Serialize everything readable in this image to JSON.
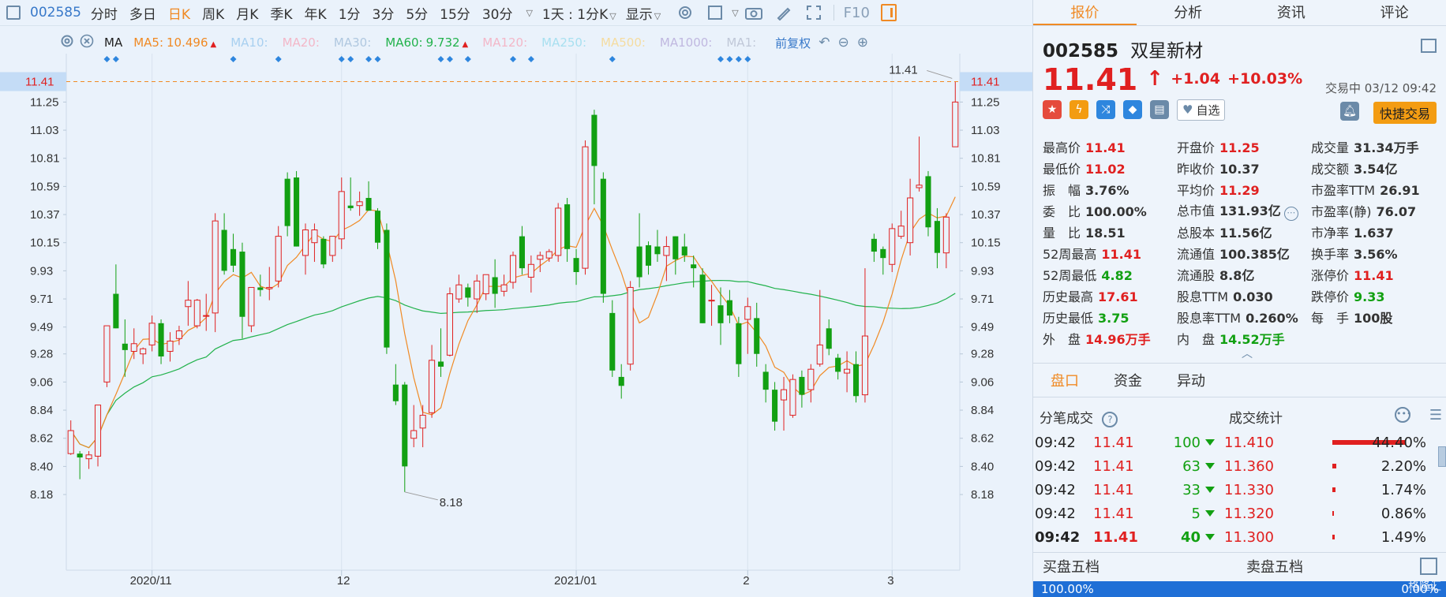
{
  "toolbar": {
    "code": "002585",
    "tabs": [
      "分时",
      "多日",
      "日K",
      "周K",
      "月K",
      "季K",
      "年K",
      "1分",
      "3分",
      "5分",
      "15分",
      "30分"
    ],
    "active_tab": "日K",
    "period_dropdown": "1天 : 1分K",
    "display_dropdown": "显示",
    "f10": "F10"
  },
  "ma_legend": {
    "selector": "MA",
    "items": [
      {
        "label": "MA5:",
        "value": "10.496",
        "color": "#f08a24",
        "up": true
      },
      {
        "label": "MA10:",
        "value": "",
        "color": "#a8d0f0",
        "up": false
      },
      {
        "label": "MA20:",
        "value": "",
        "color": "#f3b7c8",
        "up": false
      },
      {
        "label": "MA30:",
        "value": "",
        "color": "#b0c8e0",
        "up": false
      },
      {
        "label": "MA60:",
        "value": "9.732",
        "color": "#22b24c",
        "up": true
      },
      {
        "label": "MA120:",
        "value": "",
        "color": "#f3b7c8",
        "up": false
      },
      {
        "label": "MA250:",
        "value": "",
        "color": "#a8e0f0",
        "up": false
      },
      {
        "label": "MA500:",
        "value": "",
        "color": "#f5dca0",
        "up": false
      },
      {
        "label": "MA1000:",
        "value": "",
        "color": "#c0b8e0",
        "up": false
      },
      {
        "label": "MA1:",
        "value": "",
        "color": "#c0c8d8",
        "up": false
      }
    ],
    "adjust": "前复权"
  },
  "chart_data": {
    "type": "candlestick",
    "title": "",
    "y_ticks": [
      8.18,
      8.4,
      8.62,
      8.84,
      9.06,
      9.28,
      9.49,
      9.71,
      9.93,
      10.15,
      10.37,
      10.59,
      10.81,
      11.03,
      11.25
    ],
    "ylim": [
      8.02,
      11.53
    ],
    "x_labels": [
      {
        "label": "2020/11",
        "index": 9
      },
      {
        "label": "12",
        "index": 30
      },
      {
        "label": "2021/01",
        "index": 56
      },
      {
        "label": "2",
        "index": 75
      },
      {
        "label": "3",
        "index": 91
      }
    ],
    "current_price_label": "11.41",
    "high_annotation": "11.41",
    "low_annotation": "8.18",
    "candles": [
      {
        "o": 8.5,
        "h": 8.76,
        "l": 8.49,
        "c": 8.68
      },
      {
        "o": 8.5,
        "h": 8.52,
        "l": 8.3,
        "c": 8.47
      },
      {
        "o": 8.46,
        "h": 8.52,
        "l": 8.38,
        "c": 8.49
      },
      {
        "o": 8.48,
        "h": 8.88,
        "l": 8.4,
        "c": 8.88
      },
      {
        "o": 9.06,
        "h": 9.5,
        "l": 9.02,
        "c": 9.5
      },
      {
        "o": 9.75,
        "h": 9.98,
        "l": 9.48,
        "c": 9.48
      },
      {
        "o": 9.36,
        "h": 9.55,
        "l": 9.1,
        "c": 9.31
      },
      {
        "o": 9.3,
        "h": 9.48,
        "l": 9.24,
        "c": 9.36
      },
      {
        "o": 9.28,
        "h": 9.33,
        "l": 9.2,
        "c": 9.32
      },
      {
        "o": 9.35,
        "h": 9.58,
        "l": 9.3,
        "c": 9.52
      },
      {
        "o": 9.52,
        "h": 9.55,
        "l": 9.2,
        "c": 9.26
      },
      {
        "o": 9.3,
        "h": 9.45,
        "l": 9.22,
        "c": 9.38
      },
      {
        "o": 9.4,
        "h": 9.5,
        "l": 9.35,
        "c": 9.46
      },
      {
        "o": 9.65,
        "h": 9.85,
        "l": 9.5,
        "c": 9.7
      },
      {
        "o": 9.5,
        "h": 9.71,
        "l": 9.48,
        "c": 9.7
      },
      {
        "o": 9.58,
        "h": 9.75,
        "l": 9.46,
        "c": 9.58
      },
      {
        "o": 9.6,
        "h": 10.38,
        "l": 9.45,
        "c": 10.32
      },
      {
        "o": 10.25,
        "h": 10.38,
        "l": 9.9,
        "c": 9.93
      },
      {
        "o": 10.1,
        "h": 10.22,
        "l": 9.92,
        "c": 9.97
      },
      {
        "o": 10.08,
        "h": 10.15,
        "l": 9.4,
        "c": 9.57
      },
      {
        "o": 9.5,
        "h": 9.8,
        "l": 9.45,
        "c": 9.8
      },
      {
        "o": 9.8,
        "h": 9.9,
        "l": 9.73,
        "c": 9.78
      },
      {
        "o": 9.79,
        "h": 9.96,
        "l": 9.7,
        "c": 9.8
      },
      {
        "o": 9.85,
        "h": 10.28,
        "l": 9.8,
        "c": 10.2
      },
      {
        "o": 10.65,
        "h": 10.7,
        "l": 10.2,
        "c": 10.28
      },
      {
        "o": 10.66,
        "h": 10.71,
        "l": 10.12,
        "c": 10.12
      },
      {
        "o": 10.05,
        "h": 10.3,
        "l": 9.9,
        "c": 10.25
      },
      {
        "o": 10.15,
        "h": 10.3,
        "l": 10.0,
        "c": 10.25
      },
      {
        "o": 10.18,
        "h": 10.2,
        "l": 9.95,
        "c": 9.98
      },
      {
        "o": 10.05,
        "h": 10.2,
        "l": 10.0,
        "c": 10.2
      },
      {
        "o": 10.18,
        "h": 10.66,
        "l": 10.1,
        "c": 10.55
      },
      {
        "o": 10.44,
        "h": 10.66,
        "l": 10.4,
        "c": 10.42
      },
      {
        "o": 10.44,
        "h": 10.55,
        "l": 10.36,
        "c": 10.47
      },
      {
        "o": 10.5,
        "h": 10.63,
        "l": 10.4,
        "c": 10.4
      },
      {
        "o": 10.4,
        "h": 10.42,
        "l": 10.1,
        "c": 10.15
      },
      {
        "o": 10.25,
        "h": 10.3,
        "l": 9.28,
        "c": 9.33
      },
      {
        "o": 9.04,
        "h": 9.2,
        "l": 8.88,
        "c": 8.91
      },
      {
        "o": 9.04,
        "h": 9.06,
        "l": 8.2,
        "c": 8.4
      },
      {
        "o": 8.62,
        "h": 8.88,
        "l": 8.55,
        "c": 8.68
      },
      {
        "o": 8.7,
        "h": 8.88,
        "l": 8.55,
        "c": 8.8
      },
      {
        "o": 8.82,
        "h": 9.35,
        "l": 8.78,
        "c": 9.23
      },
      {
        "o": 9.22,
        "h": 9.48,
        "l": 9.1,
        "c": 9.18
      },
      {
        "o": 9.27,
        "h": 9.8,
        "l": 9.26,
        "c": 9.75
      },
      {
        "o": 9.71,
        "h": 9.9,
        "l": 9.68,
        "c": 9.82
      },
      {
        "o": 9.8,
        "h": 9.83,
        "l": 9.65,
        "c": 9.72
      },
      {
        "o": 9.71,
        "h": 9.9,
        "l": 9.6,
        "c": 9.85
      },
      {
        "o": 9.75,
        "h": 9.9,
        "l": 9.7,
        "c": 9.9
      },
      {
        "o": 9.88,
        "h": 10.02,
        "l": 9.64,
        "c": 9.75
      },
      {
        "o": 9.77,
        "h": 9.9,
        "l": 9.73,
        "c": 9.82
      },
      {
        "o": 9.84,
        "h": 10.08,
        "l": 9.79,
        "c": 10.05
      },
      {
        "o": 10.2,
        "h": 10.28,
        "l": 9.9,
        "c": 9.95
      },
      {
        "o": 9.88,
        "h": 10.05,
        "l": 9.76,
        "c": 9.98
      },
      {
        "o": 10.02,
        "h": 10.08,
        "l": 9.92,
        "c": 10.05
      },
      {
        "o": 10.03,
        "h": 10.1,
        "l": 10.0,
        "c": 10.08
      },
      {
        "o": 10.05,
        "h": 10.46,
        "l": 10.0,
        "c": 10.42
      },
      {
        "o": 10.45,
        "h": 10.5,
        "l": 10.0,
        "c": 10.1
      },
      {
        "o": 10.03,
        "h": 10.1,
        "l": 9.82,
        "c": 9.92
      },
      {
        "o": 9.95,
        "h": 10.95,
        "l": 9.9,
        "c": 10.9
      },
      {
        "o": 11.15,
        "h": 11.19,
        "l": 10.45,
        "c": 10.75
      },
      {
        "o": 10.65,
        "h": 10.7,
        "l": 9.68,
        "c": 9.75
      },
      {
        "o": 9.6,
        "h": 9.7,
        "l": 9.1,
        "c": 9.15
      },
      {
        "o": 9.1,
        "h": 9.2,
        "l": 8.93,
        "c": 9.03
      },
      {
        "o": 9.2,
        "h": 9.85,
        "l": 9.15,
        "c": 9.8
      },
      {
        "o": 10.12,
        "h": 10.38,
        "l": 9.8,
        "c": 9.88
      },
      {
        "o": 10.13,
        "h": 10.16,
        "l": 9.9,
        "c": 9.97
      },
      {
        "o": 10.12,
        "h": 10.25,
        "l": 10.0,
        "c": 10.06
      },
      {
        "o": 10.05,
        "h": 10.2,
        "l": 9.85,
        "c": 10.12
      },
      {
        "o": 10.2,
        "h": 10.2,
        "l": 9.9,
        "c": 10.02
      },
      {
        "o": 10.12,
        "h": 10.22,
        "l": 10.0,
        "c": 10.05
      },
      {
        "o": 9.98,
        "h": 10.05,
        "l": 9.8,
        "c": 9.95
      },
      {
        "o": 9.9,
        "h": 9.95,
        "l": 9.52,
        "c": 9.52
      },
      {
        "o": 9.7,
        "h": 9.82,
        "l": 9.5,
        "c": 9.7
      },
      {
        "o": 9.66,
        "h": 9.8,
        "l": 9.35,
        "c": 9.52
      },
      {
        "o": 9.7,
        "h": 9.78,
        "l": 9.52,
        "c": 9.58
      },
      {
        "o": 9.52,
        "h": 9.57,
        "l": 9.1,
        "c": 9.2
      },
      {
        "o": 9.55,
        "h": 9.72,
        "l": 9.28,
        "c": 9.65
      },
      {
        "o": 9.56,
        "h": 9.68,
        "l": 9.18,
        "c": 9.28
      },
      {
        "o": 9.14,
        "h": 9.2,
        "l": 8.9,
        "c": 9.0
      },
      {
        "o": 9.0,
        "h": 9.06,
        "l": 8.68,
        "c": 8.75
      },
      {
        "o": 8.92,
        "h": 9.1,
        "l": 8.68,
        "c": 9.0
      },
      {
        "o": 8.8,
        "h": 9.12,
        "l": 8.78,
        "c": 9.08
      },
      {
        "o": 9.1,
        "h": 9.15,
        "l": 8.86,
        "c": 8.96
      },
      {
        "o": 9.0,
        "h": 9.2,
        "l": 8.9,
        "c": 9.16
      },
      {
        "o": 9.2,
        "h": 9.78,
        "l": 9.18,
        "c": 9.35
      },
      {
        "o": 9.48,
        "h": 9.55,
        "l": 9.27,
        "c": 9.32
      },
      {
        "o": 9.25,
        "h": 9.28,
        "l": 9.08,
        "c": 9.14
      },
      {
        "o": 9.13,
        "h": 9.3,
        "l": 8.98,
        "c": 9.16
      },
      {
        "o": 9.2,
        "h": 9.3,
        "l": 8.9,
        "c": 8.95
      },
      {
        "o": 8.96,
        "h": 9.95,
        "l": 8.9,
        "c": 9.42
      },
      {
        "o": 10.18,
        "h": 10.22,
        "l": 10.0,
        "c": 10.08
      },
      {
        "o": 10.1,
        "h": 10.12,
        "l": 9.9,
        "c": 10.03
      },
      {
        "o": 9.98,
        "h": 10.3,
        "l": 9.92,
        "c": 10.26
      },
      {
        "o": 10.2,
        "h": 10.4,
        "l": 10.18,
        "c": 10.28
      },
      {
        "o": 10.15,
        "h": 10.65,
        "l": 10.05,
        "c": 10.5
      },
      {
        "o": 10.58,
        "h": 10.98,
        "l": 10.55,
        "c": 10.6
      },
      {
        "o": 10.67,
        "h": 10.71,
        "l": 10.2,
        "c": 10.27
      },
      {
        "o": 10.32,
        "h": 10.42,
        "l": 9.95,
        "c": 10.07
      },
      {
        "o": 10.07,
        "h": 10.38,
        "l": 9.95,
        "c": 10.35
      },
      {
        "o": 10.9,
        "h": 11.41,
        "l": 11.02,
        "c": 11.25
      }
    ]
  },
  "quote_panel": {
    "tabs": [
      "报价",
      "分析",
      "资讯",
      "评论"
    ],
    "active_tab": "报价",
    "code": "002585",
    "name": "双星新材",
    "price": "11.41",
    "arrow": "↑",
    "change": "+1.04",
    "change_pct": "+10.03%",
    "status": "交易中 03/12 09:42",
    "watch_label": "自选",
    "quick_trade": "快捷交易",
    "stats": [
      [
        {
          "label": "最高价",
          "value": "11.41",
          "color": "red"
        },
        {
          "label": "开盘价",
          "value": "11.25",
          "color": "red"
        },
        {
          "label": "成交量",
          "value": "31.34万手",
          "color": "dark"
        }
      ],
      [
        {
          "label": "最低价",
          "value": "11.02",
          "color": "red"
        },
        {
          "label": "昨收价",
          "value": "10.37",
          "color": "dark"
        },
        {
          "label": "成交额",
          "value": "3.54亿",
          "color": "dark"
        }
      ],
      [
        {
          "label": "振　幅",
          "value": "3.76%",
          "color": "dark"
        },
        {
          "label": "平均价",
          "value": "11.29",
          "color": "red"
        },
        {
          "label": "市盈率TTM",
          "value": "26.91",
          "color": "dark"
        }
      ],
      [
        {
          "label": "委　比",
          "value": "100.00%",
          "color": "dark"
        },
        {
          "label": "总市值",
          "value": "131.93亿",
          "color": "dark"
        },
        {
          "label": "市盈率(静)",
          "value": "76.07",
          "color": "dark"
        }
      ],
      [
        {
          "label": "量　比",
          "value": "18.51",
          "color": "dark"
        },
        {
          "label": "总股本",
          "value": "11.56亿",
          "color": "dark"
        },
        {
          "label": "市净率",
          "value": "1.637",
          "color": "dark"
        }
      ],
      [
        {
          "label": "52周最高",
          "value": "11.41",
          "color": "red"
        },
        {
          "label": "流通值",
          "value": "100.385亿",
          "color": "dark"
        },
        {
          "label": "换手率",
          "value": "3.56%",
          "color": "dark"
        }
      ],
      [
        {
          "label": "52周最低",
          "value": "4.82",
          "color": "green"
        },
        {
          "label": "流通股",
          "value": "8.8亿",
          "color": "dark"
        },
        {
          "label": "涨停价",
          "value": "11.41",
          "color": "red"
        }
      ],
      [
        {
          "label": "历史最高",
          "value": "17.61",
          "color": "red"
        },
        {
          "label": "股息TTM",
          "value": "0.030",
          "color": "dark"
        },
        {
          "label": "跌停价",
          "value": "9.33",
          "color": "green"
        }
      ],
      [
        {
          "label": "历史最低",
          "value": "3.75",
          "color": "green"
        },
        {
          "label": "股息率TTM",
          "value": "0.260%",
          "color": "dark"
        },
        {
          "label": "每　手",
          "value": "100股",
          "color": "dark"
        }
      ],
      [
        {
          "label": "外　盘",
          "value": "14.96万手",
          "color": "red"
        },
        {
          "label": "内　盘",
          "value": "14.52万手",
          "color": "green"
        },
        {
          "label": "",
          "value": "",
          "color": "dark"
        }
      ]
    ],
    "sub_tabs": [
      "盘口",
      "资金",
      "异动"
    ],
    "active_sub_tab": "盘口",
    "ticks_title": "分笔成交",
    "volume_stats_title": "成交统计",
    "ticks": [
      {
        "time": "09:42",
        "price": "11.41",
        "vol": "100",
        "bold": false
      },
      {
        "time": "09:42",
        "price": "11.41",
        "vol": "63",
        "bold": false
      },
      {
        "time": "09:42",
        "price": "11.41",
        "vol": "33",
        "bold": false
      },
      {
        "time": "09:42",
        "price": "11.41",
        "vol": "5",
        "bold": false
      },
      {
        "time": "09:42",
        "price": "11.41",
        "vol": "40",
        "bold": true
      }
    ],
    "volume_stats": [
      {
        "price": "11.410",
        "pct": "44.40%",
        "frac": 0.444
      },
      {
        "price": "11.360",
        "pct": "2.20%",
        "frac": 0.022
      },
      {
        "price": "11.330",
        "pct": "1.74%",
        "frac": 0.0174
      },
      {
        "price": "11.320",
        "pct": "0.86%",
        "frac": 0.0086
      },
      {
        "price": "11.300",
        "pct": "1.49%",
        "frac": 0.0149
      }
    ],
    "buy_book_title": "买盘五档",
    "sell_book_title": "卖盘五档",
    "buy_ratio": "100.00%",
    "sell_ratio": "0.00%",
    "watermark": "格隆汇"
  }
}
